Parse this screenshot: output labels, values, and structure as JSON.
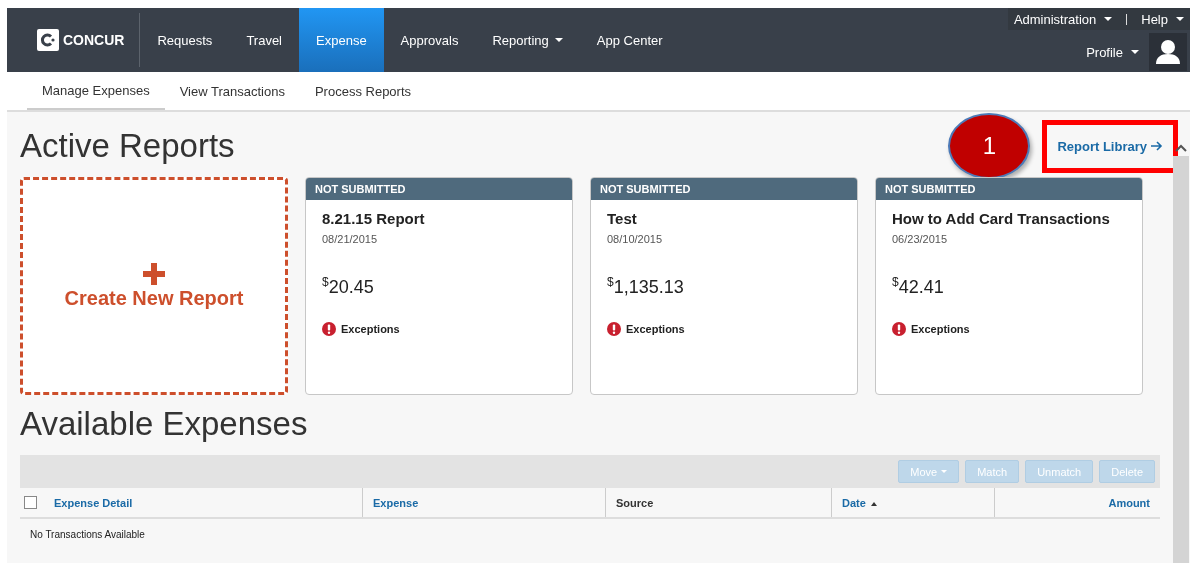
{
  "header": {
    "logo": "CONCUR",
    "nav": [
      {
        "label": "Requests",
        "selected": false,
        "dropdown": false
      },
      {
        "label": "Travel",
        "selected": false,
        "dropdown": false
      },
      {
        "label": "Expense",
        "selected": true,
        "dropdown": false
      },
      {
        "label": "Approvals",
        "selected": false,
        "dropdown": false
      },
      {
        "label": "Reporting",
        "selected": false,
        "dropdown": true
      },
      {
        "label": "App Center",
        "selected": false,
        "dropdown": false
      }
    ],
    "utility": [
      {
        "label": "Administration"
      },
      {
        "label": "Help"
      }
    ],
    "profile": "Profile"
  },
  "subnav": [
    {
      "label": "Manage Expenses",
      "selected": true
    },
    {
      "label": "View Transactions",
      "selected": false
    },
    {
      "label": "Process Reports",
      "selected": false
    }
  ],
  "active_reports": {
    "title": "Active Reports",
    "callout": "1",
    "library_link": "Report Library",
    "create": "Create New Report",
    "reports": [
      {
        "status": "NOT SUBMITTED",
        "name": "8.21.15 Report",
        "date": "08/21/2015",
        "currency": "$",
        "amount": "20.45",
        "alert": "Exceptions"
      },
      {
        "status": "NOT SUBMITTED",
        "name": "Test",
        "date": "08/10/2015",
        "currency": "$",
        "amount": "1,135.13",
        "alert": "Exceptions"
      },
      {
        "status": "NOT SUBMITTED",
        "name": "How to Add Card Transactions",
        "date": "06/23/2015",
        "currency": "$",
        "amount": "42.41",
        "alert": "Exceptions"
      }
    ]
  },
  "available_expenses": {
    "title": "Available Expenses",
    "toolbar": [
      {
        "label": "Move",
        "disabled": true,
        "dropdown": true
      },
      {
        "label": "Match",
        "disabled": true,
        "dropdown": false
      },
      {
        "label": "Unmatch",
        "disabled": true,
        "dropdown": false
      },
      {
        "label": "Delete",
        "disabled": true,
        "dropdown": false
      }
    ],
    "select_all": {
      "checked": false
    },
    "columns": [
      {
        "label": "Expense Detail",
        "sortable": true,
        "sorted": false
      },
      {
        "label": "Expense",
        "sortable": true,
        "sorted": false
      },
      {
        "label": "Source",
        "sortable": false,
        "sorted": false
      },
      {
        "label": "Date",
        "sortable": true,
        "sorted": true
      },
      {
        "label": "Amount",
        "sortable": true,
        "sorted": false
      }
    ],
    "empty_message": "No Transactions Available"
  }
}
